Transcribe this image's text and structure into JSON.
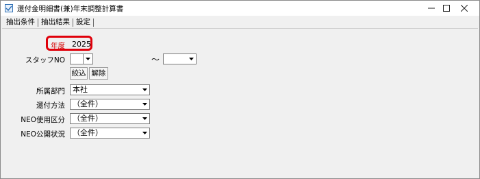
{
  "window": {
    "title": "還付金明細書(兼)年末調整計算書",
    "icon": "document-app-icon",
    "controls": [
      "minimize-icon",
      "maximize-icon",
      "close-icon"
    ]
  },
  "tabs": [
    {
      "label": "抽出条件"
    },
    {
      "label": "抽出結果"
    },
    {
      "label": "設定"
    }
  ],
  "form": {
    "year": {
      "label": "年度",
      "value": "2025"
    },
    "staff_no": {
      "label": "スタッフNO",
      "from_value": "",
      "to_value": "",
      "range_separator": "～"
    },
    "buttons": {
      "filter": "絞込",
      "clear": "解除"
    },
    "department": {
      "label": "所属部門",
      "value": "本社"
    },
    "payment_method": {
      "label": "還付方法",
      "value": "（全件）"
    },
    "neo_usage": {
      "label": "NEO使用区分",
      "value": "（全件）"
    },
    "neo_public": {
      "label": "NEO公開状況",
      "value": "（全件）"
    }
  },
  "colors": {
    "highlight": "#e0000a",
    "year_label": "#d40000"
  }
}
